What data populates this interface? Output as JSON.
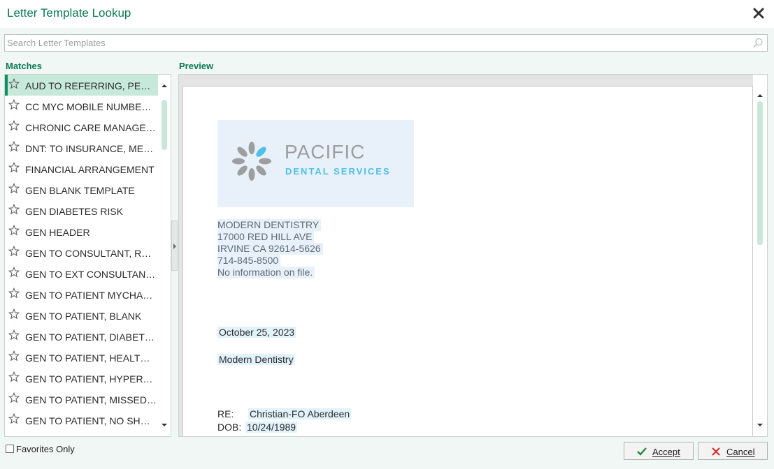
{
  "window": {
    "title": "Letter Template Lookup"
  },
  "search": {
    "placeholder": "Search Letter Templates",
    "value": ""
  },
  "matches": {
    "label": "Matches",
    "items": [
      {
        "label": "AUD TO REFERRING, PED DEV SCREEN",
        "selected": true
      },
      {
        "label": "CC MYC MOBILE NUMBER CONFIRMATION"
      },
      {
        "label": "CHRONIC CARE MANAGEMENT"
      },
      {
        "label": "DNT: TO INSURANCE, MEDICAL NECESSITY"
      },
      {
        "label": "FINANCIAL ARRANGEMENT"
      },
      {
        "label": "GEN BLANK TEMPLATE"
      },
      {
        "label": "GEN DIABETES RISK"
      },
      {
        "label": "GEN HEADER"
      },
      {
        "label": "GEN TO CONSULTANT, REFERRAL"
      },
      {
        "label": "GEN TO EXT CONSULTANT, REFERRAL"
      },
      {
        "label": "GEN TO PATIENT MYCHART ACTIVATION"
      },
      {
        "label": "GEN TO PATIENT, BLANK"
      },
      {
        "label": "GEN TO PATIENT, DIABETES"
      },
      {
        "label": "GEN TO PATIENT, HEALTH MAINTENANCE"
      },
      {
        "label": "GEN TO PATIENT, HYPERTENSION"
      },
      {
        "label": "GEN TO PATIENT, MISSED APPOINTMENT"
      },
      {
        "label": "GEN TO PATIENT, NO SHOW"
      }
    ]
  },
  "preview": {
    "label": "Preview",
    "logo": {
      "word1": "PACIFIC",
      "word2": "DENTAL SERVICES",
      "brand_gray": "#9c9ea0",
      "brand_blue": "#4fc0e6"
    },
    "practice": {
      "name": "MODERN DENTISTRY",
      "address1": "17000 RED HILL AVE",
      "address2": "IRVINE CA 92614-5626",
      "phone": "714-845-8500",
      "extra": "No information on file."
    },
    "date": "October 25, 2023",
    "recipient": "Modern Dentistry",
    "re_label": "RE:",
    "re_value": "Christian-FO Aberdeen",
    "dob_label": "DOB:",
    "dob_value": "10/24/1989"
  },
  "footer": {
    "favorites_label": "Favorites Only",
    "favorites_checked": false,
    "accept_label": "Accept",
    "cancel_label": "Cancel"
  },
  "colors": {
    "accent": "#0a7a53",
    "selected_row": "#c6e9dc",
    "cancel_icon": "#d23030",
    "accept_icon": "#1f8a3a"
  },
  "icons": [
    "close-icon",
    "search-icon",
    "star-icon",
    "chevron-up-icon",
    "chevron-down-icon",
    "check-icon",
    "x-icon"
  ]
}
